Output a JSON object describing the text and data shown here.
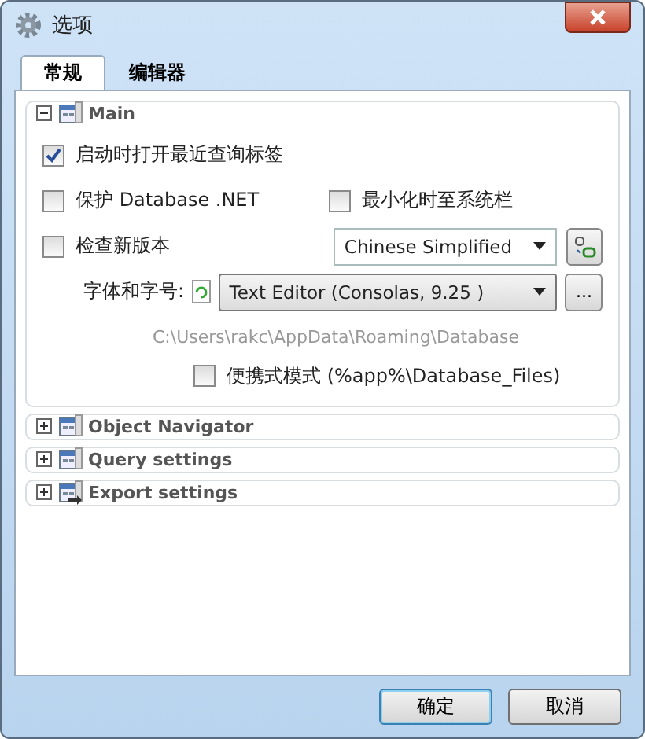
{
  "window": {
    "title": "选项"
  },
  "tabs": [
    {
      "label": "常规",
      "selected": true
    },
    {
      "label": "编辑器",
      "selected": false
    }
  ],
  "sections": [
    {
      "title": "Main",
      "expanded": true
    },
    {
      "title": "Object Navigator",
      "expanded": false
    },
    {
      "title": "Query settings",
      "expanded": false
    },
    {
      "title": "Export settings",
      "expanded": false
    }
  ],
  "main": {
    "open_recent": {
      "label": "启动时打开最近查询标签",
      "checked": true
    },
    "protect": {
      "label": "保护 Database .NET",
      "checked": false
    },
    "minimize_tray": {
      "label": "最小化时至系统栏",
      "checked": false
    },
    "check_updates": {
      "label": "检查新版本",
      "checked": false
    },
    "language": {
      "value": "Chinese Simplified"
    },
    "font": {
      "label": "字体和字号:",
      "value": "Text Editor (Consolas, 9.25 )",
      "browse": "..."
    },
    "path": "C:\\Users\\rakc\\AppData\\Roaming\\Database",
    "portable": {
      "label": "便携式模式 (%app%\\Database_Files)",
      "checked": false
    }
  },
  "buttons": [
    {
      "label": "确定",
      "default": true
    },
    {
      "label": "取消",
      "default": false
    }
  ]
}
